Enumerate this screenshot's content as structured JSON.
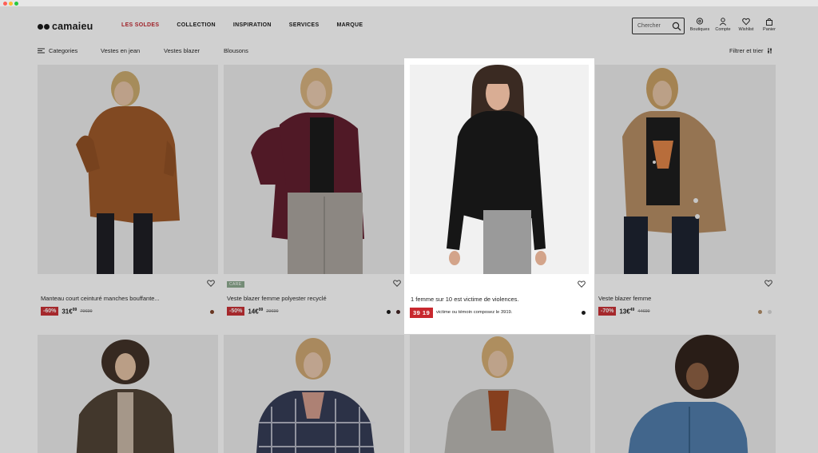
{
  "brand": {
    "name": "camaieu"
  },
  "nav": {
    "items": [
      {
        "label": "LES SOLDES",
        "sale": true
      },
      {
        "label": "COLLECTION",
        "sale": false
      },
      {
        "label": "INSPIRATION",
        "sale": false
      },
      {
        "label": "SERVICES",
        "sale": false
      },
      {
        "label": "MARQUE",
        "sale": false
      }
    ]
  },
  "search": {
    "placeholder": "Chercher"
  },
  "header_icons": [
    {
      "icon": "location-icon",
      "label": "Boutiques"
    },
    {
      "icon": "user-icon",
      "label": "Compte"
    },
    {
      "icon": "heart-icon",
      "label": "Wishlist"
    },
    {
      "icon": "bag-icon",
      "label": "Panier"
    }
  ],
  "subnav": {
    "categories_label": "Categories",
    "chips": [
      "Vestes en jean",
      "Vestes blazer",
      "Blousons"
    ],
    "filter_label": "Filtrer et trier"
  },
  "products": [
    {
      "name": "Manteau court ceinturé manches bouffante...",
      "discount": "-60%",
      "price": "31€",
      "price_cents": "99",
      "old_price": "79€99",
      "tag": "",
      "swatches": [
        "#7a3a1f"
      ]
    },
    {
      "name": "Veste blazer femme polyester recyclé",
      "discount": "-50%",
      "price": "14€",
      "price_cents": "99",
      "old_price": "29€99",
      "tag": "CARE",
      "swatches": [
        "#111111",
        "#3b1a1a"
      ]
    },
    {
      "name": "Veste blazer femme",
      "discount": "-70%",
      "price": "13€",
      "price_cents": "49",
      "old_price": "44€99",
      "tag": "",
      "swatches": [
        "#b08a62",
        "#d9d9d9"
      ]
    }
  ],
  "psa": {
    "message": "1 femme sur 10 est victime de violences.",
    "number": "39 19",
    "subtext": "victime ou témoin composez le 3919.",
    "swatch": "#1a1a1a"
  },
  "colors": {
    "sale": "#c0202a",
    "discount_bg": "#c8282e",
    "care_tag": "#8aa88c"
  }
}
